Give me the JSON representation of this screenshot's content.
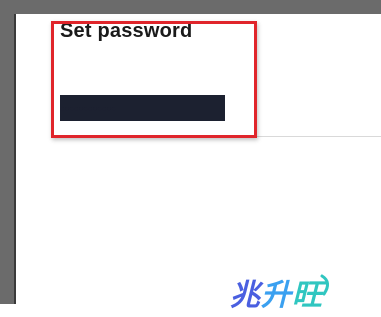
{
  "dialog": {
    "title": "Set password",
    "password_value": "••••••••••••"
  },
  "highlight": {
    "color": "#e0252b"
  },
  "watermark": {
    "text": "兆升旺",
    "colors": [
      "#4a5fe0",
      "#3aa0f0",
      "#30c6c0"
    ]
  }
}
